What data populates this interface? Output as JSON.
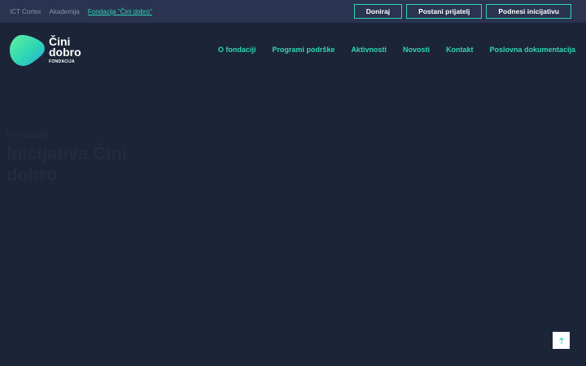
{
  "topbar": {
    "links": [
      {
        "label": "ICT Cortex"
      },
      {
        "label": "Akademija"
      },
      {
        "label": "Fondacija \"Čini dobro\""
      }
    ],
    "buttons": [
      {
        "label": "Doniraj"
      },
      {
        "label": "Postani prijatelj"
      },
      {
        "label": "Podnesi inicijativu"
      }
    ]
  },
  "logo": {
    "line1": "Čini",
    "line2": "dobro",
    "line3": "FONDACIJA"
  },
  "nav": {
    "items": [
      {
        "label": "O fondaciji"
      },
      {
        "label": "Programi podrške"
      },
      {
        "label": "Aktivnosti"
      },
      {
        "label": "Novosti"
      },
      {
        "label": "Kontakt"
      },
      {
        "label": "Poslovna dokumentacija"
      }
    ]
  },
  "hero": {
    "eyebrow": "Fondacija",
    "title": "Inicijativa Čini dobro"
  },
  "colors": {
    "background": "#1c2438",
    "topbar": "#2a3350",
    "accent": "#2fd6b3",
    "text": "#ffffff"
  },
  "icons": {
    "scroll_top": "arrow-up-icon",
    "logo": "cini-dobro-logo-mark"
  }
}
